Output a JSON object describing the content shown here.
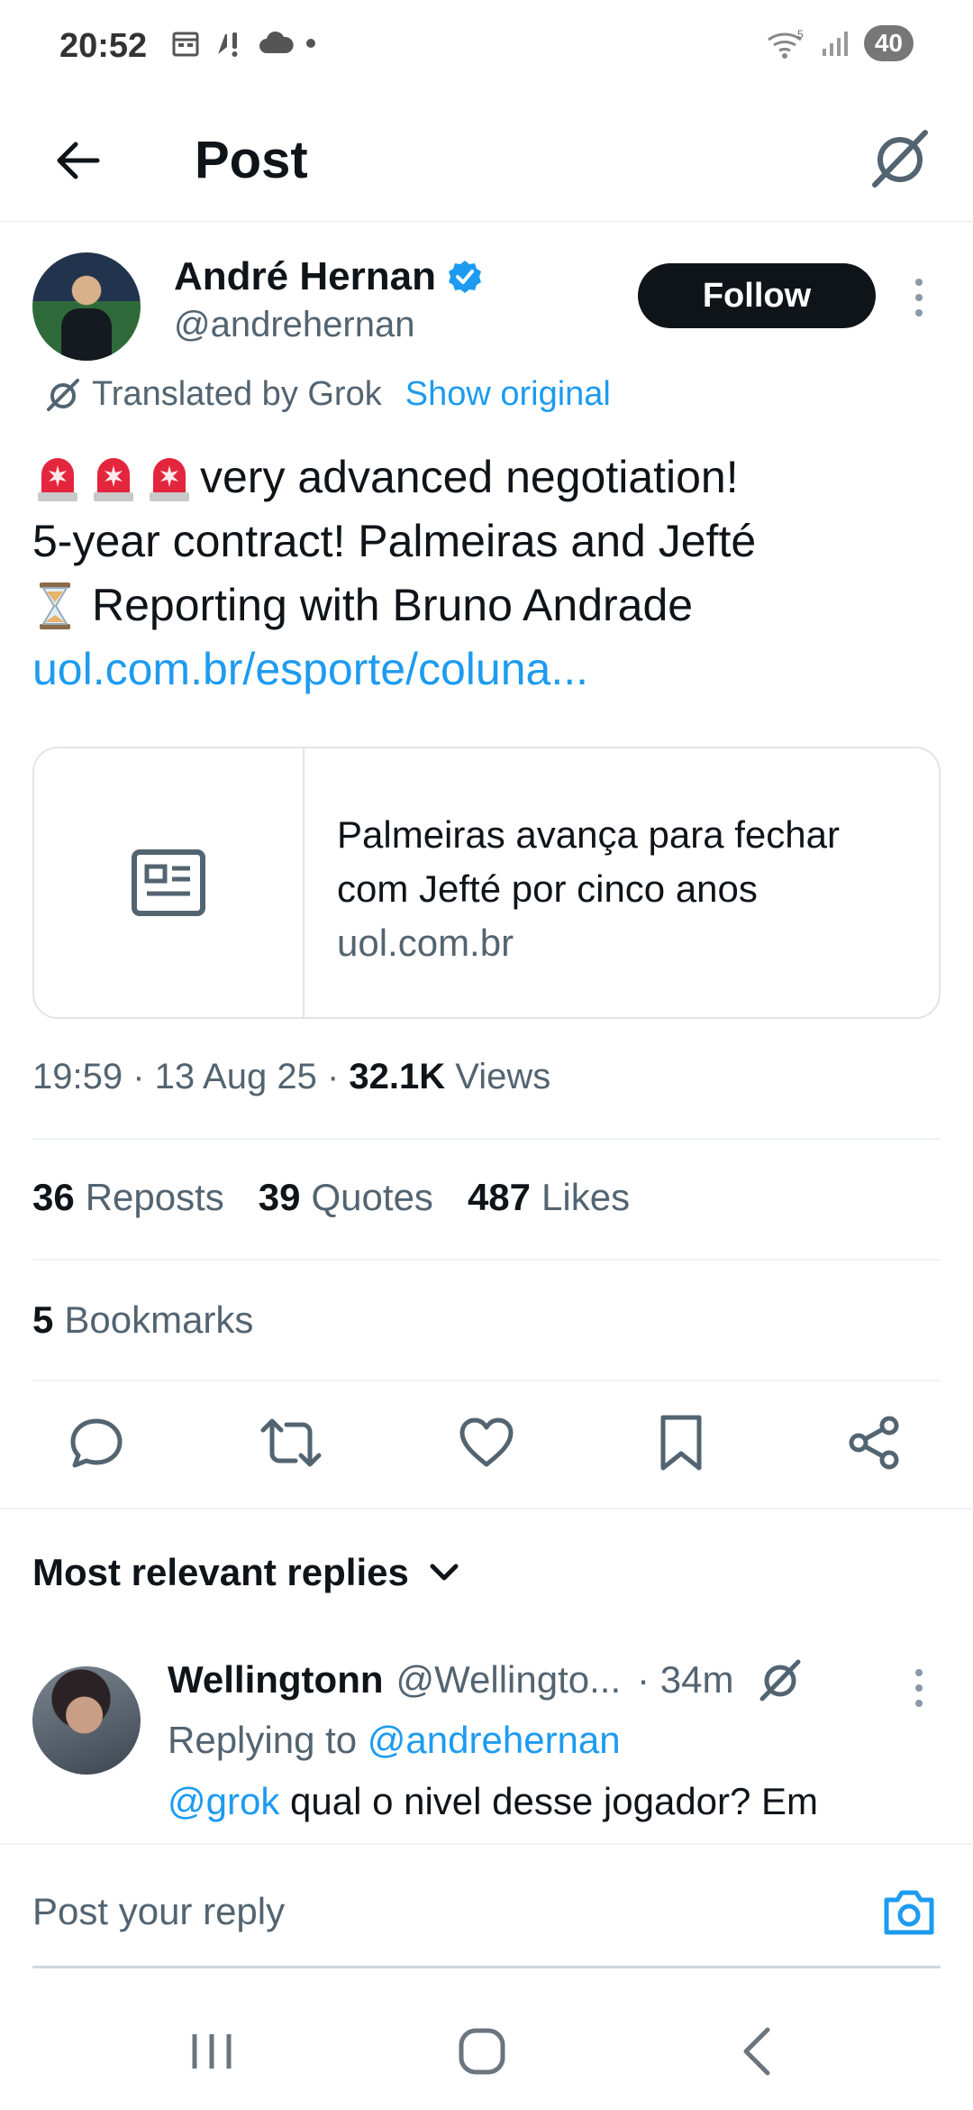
{
  "status_bar": {
    "time": "20:52",
    "battery": "40"
  },
  "header": {
    "title": "Post"
  },
  "author": {
    "name": "André Hernan",
    "handle": "@andrehernan",
    "follow_label": "Follow"
  },
  "translation": {
    "label": "Translated by Grok",
    "show_original": "Show original"
  },
  "post": {
    "line1": "very advanced negotiation!",
    "line2": "5-year contract! Palmeiras and Jefté",
    "line3": "Reporting with Bruno Andrade",
    "link": "uol.com.br/esporte/coluna..."
  },
  "link_card": {
    "title_line1": "Palmeiras avança para fechar",
    "title_line2": "com Jefté por cinco anos",
    "domain": "uol.com.br"
  },
  "meta": {
    "time": "19:59",
    "date": "13 Aug 25",
    "views_count": "32.1K",
    "views_label": "Views"
  },
  "stats": {
    "reposts_count": "36",
    "reposts_label": "Reposts",
    "quotes_count": "39",
    "quotes_label": "Quotes",
    "likes_count": "487",
    "likes_label": "Likes",
    "bookmarks_count": "5",
    "bookmarks_label": "Bookmarks"
  },
  "replies": {
    "filter_label": "Most relevant replies",
    "items": [
      {
        "name": "Wellingtonn",
        "handle": "@Wellingto...",
        "time": "· 34m",
        "replying_label": "Replying to",
        "replying_handle": "@andrehernan",
        "mention": "@grok",
        "text": "qual o nivel desse jogador? Em"
      }
    ]
  },
  "composer": {
    "placeholder": "Post your reply"
  },
  "colors": {
    "accent": "#1d9bf0",
    "text": "#0f1419",
    "muted": "#536471",
    "border": "#eff3f4"
  }
}
